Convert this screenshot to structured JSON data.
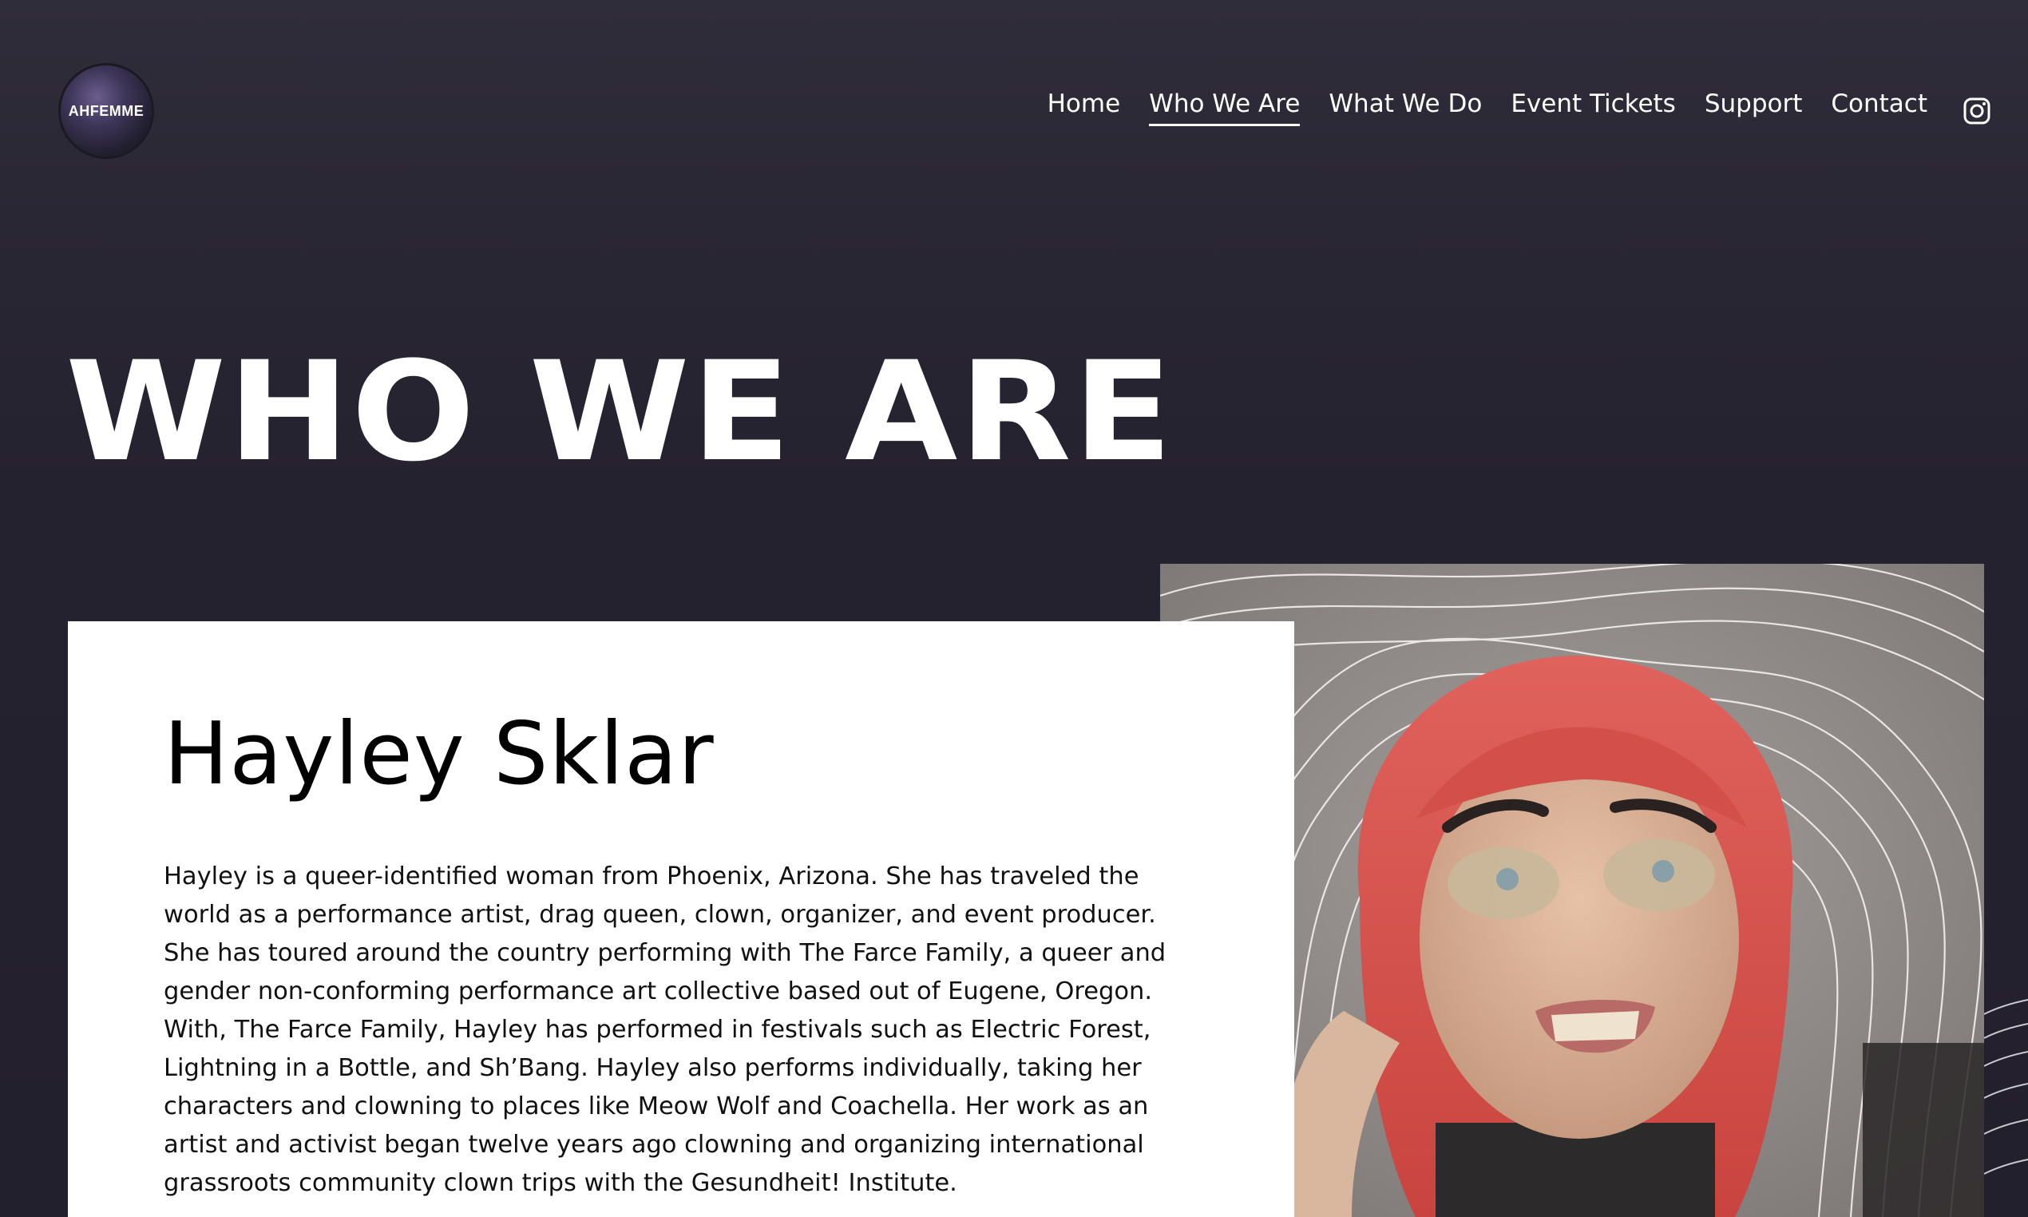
{
  "brand": {
    "logo_text": "AHFEMME"
  },
  "nav": {
    "items": [
      {
        "label": "Home"
      },
      {
        "label": "Who We Are"
      },
      {
        "label": "What We Do"
      },
      {
        "label": "Event Tickets"
      },
      {
        "label": "Support"
      },
      {
        "label": "Contact"
      }
    ],
    "active": "Who We Are",
    "social_icon": "instagram-icon"
  },
  "hero": {
    "title": "WHO WE ARE"
  },
  "bio": {
    "name": "Hayley Sklar",
    "text": "Hayley is a queer-identified woman from Phoenix, Arizona. She has traveled the world as a performance artist, drag queen, clown, organizer, and event producer. She has toured around the country performing with The Farce Family, a queer and gender non-conforming performance art collective based out of Eugene, Oregon. With, The Farce Family, Hayley has performed in festivals such as Electric Forest, Lightning in a Bottle, and Sh’Bang. Hayley also performs individually, taking her characters and clowning to places like Meow Wolf and Coachella. Her work as an artist and activist began twelve years ago clowning and organizing international grassroots community clown trips with the Gesundheit! Institute."
  },
  "colors": {
    "background": "#25222f",
    "card": "#ffffff",
    "wig": "#d9534f"
  }
}
